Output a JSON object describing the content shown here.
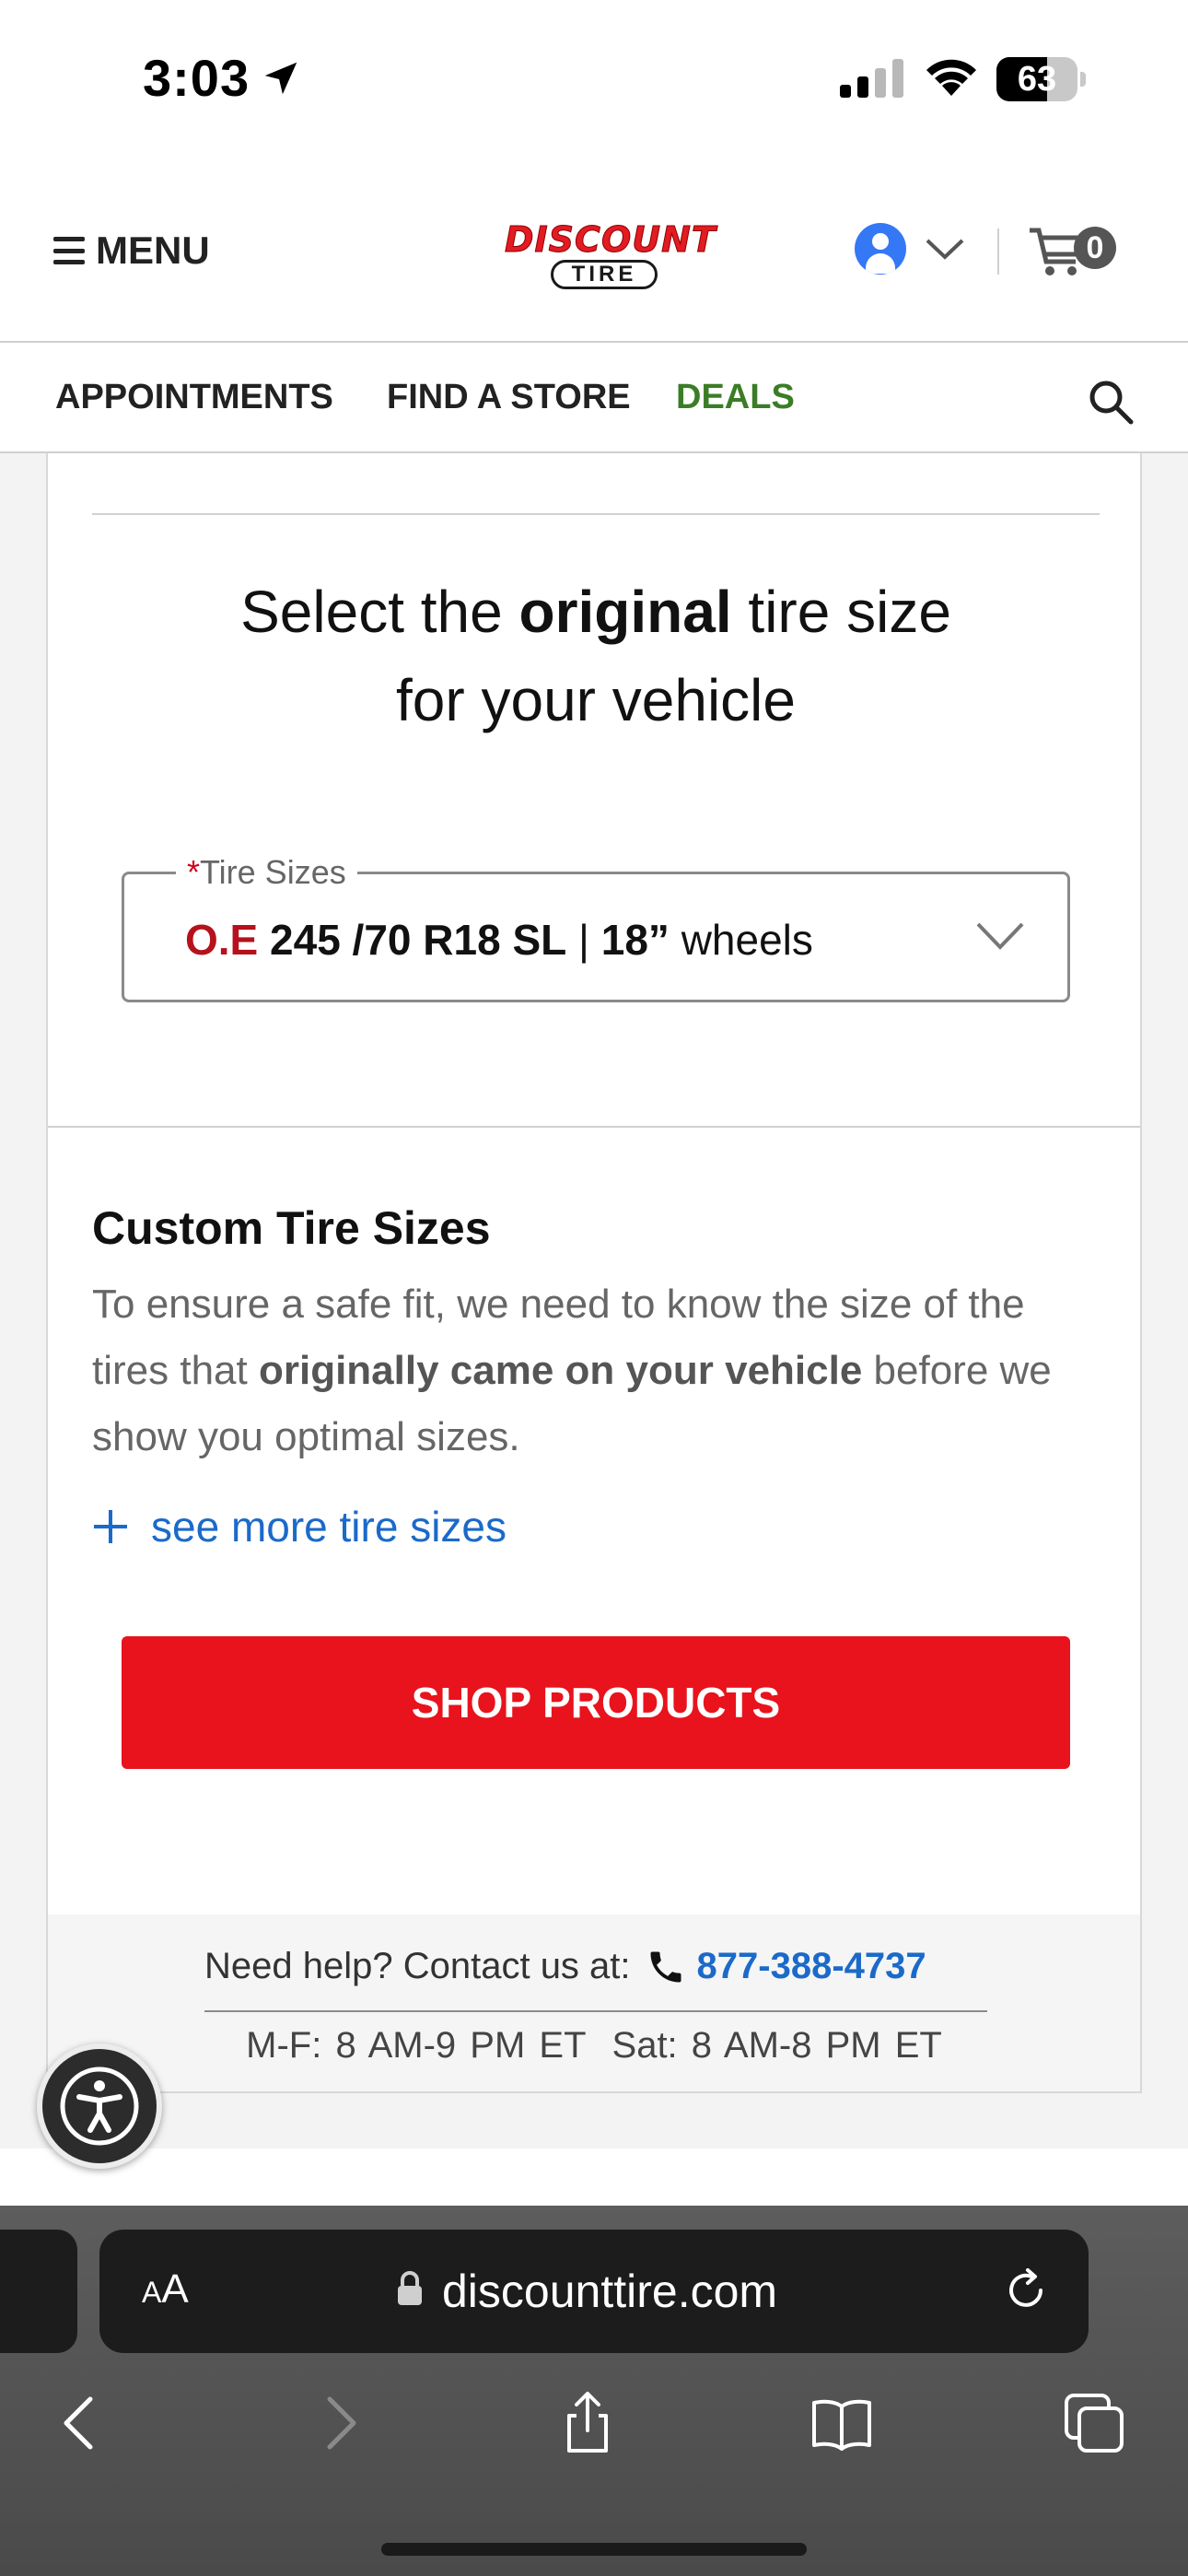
{
  "status_bar": {
    "time": "3:03",
    "battery": "63",
    "battery_level": 0.63
  },
  "header": {
    "menu_label": "MENU",
    "logo_top": "DISCOUNT",
    "logo_bottom": "TIRE",
    "cart_count": "0"
  },
  "nav": {
    "appointments": "APPOINTMENTS",
    "find_store": "FIND A STORE",
    "deals": "DEALS"
  },
  "selector": {
    "heading_pre": "Select the ",
    "heading_bold": "original",
    "heading_post": " tire size",
    "heading_line2": "for your vehicle",
    "field_required": "*",
    "field_label": "Tire Sizes",
    "value_oe": "O.E",
    "value_size": "245 /70 R18 SL",
    "value_sep": "|",
    "value_wheel": "18”",
    "value_suffix": "wheels"
  },
  "custom": {
    "title": "Custom Tire Sizes",
    "desc_pre": "To ensure a safe fit, we need to know the size of the tires that ",
    "desc_bold": "originally came on your vehicle",
    "desc_post": " before we show you optimal sizes.",
    "see_more": "see more tire sizes"
  },
  "shop_button": "SHOP PRODUCTS",
  "help": {
    "prefix": "Need help? Contact us at:",
    "phone": "877-388-4737",
    "hours_weekday": "M-F: 8 AM-9 PM ET",
    "hours_sat": "Sat: 8 AM-8 PM ET"
  },
  "browser": {
    "aa_small": "A",
    "aa_large": "A",
    "url": "discounttire.com"
  },
  "colors": {
    "brand_red": "#e8131c",
    "deals_green": "#3b7d27",
    "link_blue": "#1b6ac9",
    "avatar_blue": "#3478f6"
  }
}
